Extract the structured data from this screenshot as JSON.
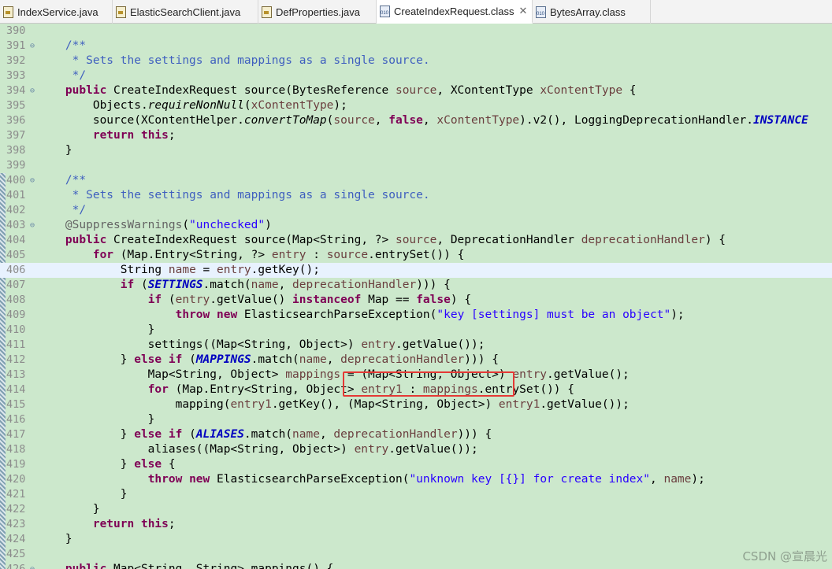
{
  "tabs": [
    {
      "label": "IndexService.java",
      "kind": "java"
    },
    {
      "label": "ElasticSearchClient.java",
      "kind": "java"
    },
    {
      "label": "DefProperties.java",
      "kind": "java"
    },
    {
      "label": "CreateIndexRequest.class",
      "kind": "class",
      "active": true,
      "close": "✕"
    },
    {
      "label": "BytesArray.class",
      "kind": "class"
    }
  ],
  "current_line": 406,
  "lines": [
    {
      "n": 390,
      "t": []
    },
    {
      "n": 391,
      "f": true,
      "t": [
        [
          "cm",
          "    /**"
        ]
      ]
    },
    {
      "n": 392,
      "t": [
        [
          "cm",
          "     * Sets the settings and mappings as a single source."
        ]
      ]
    },
    {
      "n": 393,
      "t": [
        [
          "cm",
          "     */"
        ]
      ]
    },
    {
      "n": 394,
      "f": true,
      "t": [
        [
          "",
          "    "
        ],
        [
          "kw",
          "public"
        ],
        [
          "",
          " CreateIndexRequest source(BytesReference "
        ],
        [
          "pm",
          "source"
        ],
        [
          "",
          ", XContentType "
        ],
        [
          "pm",
          "xContentType"
        ],
        [
          "",
          " {"
        ]
      ]
    },
    {
      "n": 395,
      "t": [
        [
          "",
          "        Objects."
        ],
        [
          "it",
          "requireNonNull"
        ],
        [
          "",
          "("
        ],
        [
          "pm",
          "xContentType"
        ],
        [
          "",
          ");"
        ]
      ]
    },
    {
      "n": 396,
      "t": [
        [
          "",
          "        source(XContentHelper."
        ],
        [
          "it",
          "convertToMap"
        ],
        [
          "",
          "("
        ],
        [
          "pm",
          "source"
        ],
        [
          "",
          ", "
        ],
        [
          "kw",
          "false"
        ],
        [
          "",
          ", "
        ],
        [
          "pm",
          "xContentType"
        ],
        [
          "",
          ").v2(), LoggingDeprecationHandler."
        ],
        [
          "sf",
          "INSTANCE"
        ]
      ]
    },
    {
      "n": 397,
      "t": [
        [
          "",
          "        "
        ],
        [
          "kw",
          "return"
        ],
        [
          "",
          " "
        ],
        [
          "kw",
          "this"
        ],
        [
          "",
          ";"
        ]
      ]
    },
    {
      "n": 398,
      "t": [
        [
          "",
          "    }"
        ]
      ]
    },
    {
      "n": 399,
      "t": []
    },
    {
      "n": 400,
      "f": true,
      "t": [
        [
          "cm",
          "    /**"
        ]
      ]
    },
    {
      "n": 401,
      "t": [
        [
          "cm",
          "     * Sets the settings and mappings as a single source."
        ]
      ]
    },
    {
      "n": 402,
      "t": [
        [
          "cm",
          "     */"
        ]
      ]
    },
    {
      "n": 403,
      "f": true,
      "t": [
        [
          "an",
          "    @SuppressWarnings"
        ],
        [
          "",
          "("
        ],
        [
          "st",
          "\"unchecked\""
        ],
        [
          "",
          ")"
        ]
      ]
    },
    {
      "n": 404,
      "t": [
        [
          "",
          "    "
        ],
        [
          "kw",
          "public"
        ],
        [
          "",
          " CreateIndexRequest source(Map<String, ?> "
        ],
        [
          "pm",
          "source"
        ],
        [
          "",
          ", DeprecationHandler "
        ],
        [
          "pm",
          "deprecationHandler"
        ],
        [
          "",
          ") {"
        ]
      ]
    },
    {
      "n": 405,
      "t": [
        [
          "",
          "        "
        ],
        [
          "kw",
          "for"
        ],
        [
          "",
          " (Map.Entry<String, ?> "
        ],
        [
          "pm",
          "entry"
        ],
        [
          "",
          " : "
        ],
        [
          "pm",
          "source"
        ],
        [
          "",
          ".entrySet()) {"
        ]
      ]
    },
    {
      "n": 406,
      "t": [
        [
          "",
          "            String "
        ],
        [
          "pm",
          "name"
        ],
        [
          "",
          " = "
        ],
        [
          "pm",
          "entry"
        ],
        [
          "",
          ".getKey();"
        ]
      ]
    },
    {
      "n": 407,
      "t": [
        [
          "",
          "            "
        ],
        [
          "kw",
          "if"
        ],
        [
          "",
          " ("
        ],
        [
          "sf",
          "SETTINGS"
        ],
        [
          "",
          ".match("
        ],
        [
          "pm",
          "name"
        ],
        [
          "",
          ", "
        ],
        [
          "pm",
          "deprecationHandler"
        ],
        [
          "",
          "))) {"
        ]
      ]
    },
    {
      "n": 408,
      "t": [
        [
          "",
          "                "
        ],
        [
          "kw",
          "if"
        ],
        [
          "",
          " ("
        ],
        [
          "pm",
          "entry"
        ],
        [
          "",
          ".getValue() "
        ],
        [
          "kw",
          "instanceof"
        ],
        [
          "",
          " Map == "
        ],
        [
          "kw",
          "false"
        ],
        [
          "",
          ") {"
        ]
      ]
    },
    {
      "n": 409,
      "t": [
        [
          "",
          "                    "
        ],
        [
          "kw",
          "throw"
        ],
        [
          "",
          " "
        ],
        [
          "kw",
          "new"
        ],
        [
          "",
          " ElasticsearchParseException("
        ],
        [
          "st",
          "\"key [settings] must be an object\""
        ],
        [
          "",
          ");"
        ]
      ]
    },
    {
      "n": 410,
      "t": [
        [
          "",
          "                }"
        ]
      ]
    },
    {
      "n": 411,
      "t": [
        [
          "",
          "                settings((Map<String, Object>) "
        ],
        [
          "pm",
          "entry"
        ],
        [
          "",
          ".getValue());"
        ]
      ]
    },
    {
      "n": 412,
      "t": [
        [
          "",
          "            } "
        ],
        [
          "kw",
          "else"
        ],
        [
          "",
          " "
        ],
        [
          "kw",
          "if"
        ],
        [
          "",
          " ("
        ],
        [
          "sf",
          "MAPPINGS"
        ],
        [
          "",
          ".match("
        ],
        [
          "pm",
          "name"
        ],
        [
          "",
          ", "
        ],
        [
          "pm",
          "deprecationHandler"
        ],
        [
          "",
          "))) {"
        ]
      ]
    },
    {
      "n": 413,
      "t": [
        [
          "",
          "                Map<String, Object> "
        ],
        [
          "pm",
          "mappings"
        ],
        [
          "",
          " = (Map<String, Object>) "
        ],
        [
          "pm",
          "entry"
        ],
        [
          "",
          ".getValue();"
        ]
      ]
    },
    {
      "n": 414,
      "t": [
        [
          "",
          "                "
        ],
        [
          "kw",
          "for"
        ],
        [
          "",
          " (Map.Entry<String, Object> "
        ],
        [
          "pm",
          "entry1"
        ],
        [
          "",
          " : "
        ],
        [
          "pm",
          "mappings"
        ],
        [
          "",
          ".entrySet()) {"
        ]
      ]
    },
    {
      "n": 415,
      "t": [
        [
          "",
          "                    mapping("
        ],
        [
          "pm",
          "entry1"
        ],
        [
          "",
          ".getKey(), (Map<String, Object>) "
        ],
        [
          "pm",
          "entry1"
        ],
        [
          "",
          ".getValue());"
        ]
      ]
    },
    {
      "n": 416,
      "t": [
        [
          "",
          "                }"
        ]
      ]
    },
    {
      "n": 417,
      "t": [
        [
          "",
          "            } "
        ],
        [
          "kw",
          "else"
        ],
        [
          "",
          " "
        ],
        [
          "kw",
          "if"
        ],
        [
          "",
          " ("
        ],
        [
          "sf",
          "ALIASES"
        ],
        [
          "",
          ".match("
        ],
        [
          "pm",
          "name"
        ],
        [
          "",
          ", "
        ],
        [
          "pm",
          "deprecationHandler"
        ],
        [
          "",
          "))) {"
        ]
      ]
    },
    {
      "n": 418,
      "t": [
        [
          "",
          "                aliases((Map<String, Object>) "
        ],
        [
          "pm",
          "entry"
        ],
        [
          "",
          ".getValue());"
        ]
      ]
    },
    {
      "n": 419,
      "t": [
        [
          "",
          "            } "
        ],
        [
          "kw",
          "else"
        ],
        [
          "",
          " {"
        ]
      ]
    },
    {
      "n": 420,
      "t": [
        [
          "",
          "                "
        ],
        [
          "kw",
          "throw"
        ],
        [
          "",
          " "
        ],
        [
          "kw",
          "new"
        ],
        [
          "",
          " ElasticsearchParseException("
        ],
        [
          "st",
          "\"unknown key [{}] for create index\""
        ],
        [
          "",
          ", "
        ],
        [
          "pm",
          "name"
        ],
        [
          "",
          ");"
        ]
      ]
    },
    {
      "n": 421,
      "t": [
        [
          "",
          "            }"
        ]
      ]
    },
    {
      "n": 422,
      "t": [
        [
          "",
          "        }"
        ]
      ]
    },
    {
      "n": 423,
      "t": [
        [
          "",
          "        "
        ],
        [
          "kw",
          "return"
        ],
        [
          "",
          " "
        ],
        [
          "kw",
          "this"
        ],
        [
          "",
          ";"
        ]
      ]
    },
    {
      "n": 424,
      "t": [
        [
          "",
          "    }"
        ]
      ]
    },
    {
      "n": 425,
      "t": []
    },
    {
      "n": 426,
      "f": true,
      "t": [
        [
          "",
          "    "
        ],
        [
          "kw",
          "public"
        ],
        [
          "",
          " Map<String, String> mappings() {"
        ]
      ]
    }
  ],
  "watermark": "CSDN @宣晨光"
}
